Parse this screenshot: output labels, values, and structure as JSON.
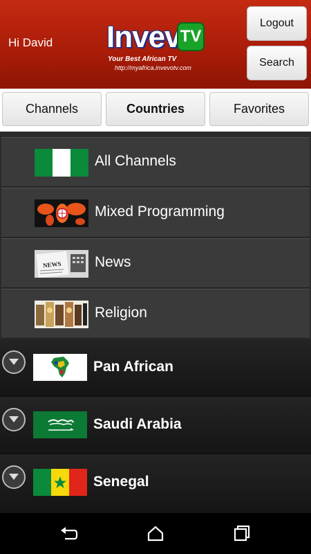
{
  "header": {
    "greeting": "Hi David",
    "logo": {
      "brand": "Invevo",
      "badge": "TV",
      "tagline": "Your Best African TV",
      "url": "http://myafrica.invevotv.com"
    },
    "logout_label": "Logout",
    "search_label": "Search"
  },
  "tabs": [
    {
      "label": "Channels",
      "selected": false
    },
    {
      "label": "Countries",
      "selected": true
    },
    {
      "label": "Favorites",
      "selected": false
    }
  ],
  "categories": [
    {
      "label": "All Channels",
      "thumb": "nigeria-flag"
    },
    {
      "label": "Mixed Programming",
      "thumb": "world-map"
    },
    {
      "label": "News",
      "thumb": "newspaper"
    },
    {
      "label": "Religion",
      "thumb": "religion-collage"
    }
  ],
  "countries": [
    {
      "label": "Pan African",
      "flag": "pan-african-map-flag"
    },
    {
      "label": "Saudi Arabia",
      "flag": "saudi-arabia-flag"
    },
    {
      "label": "Senegal",
      "flag": "senegal-flag"
    }
  ],
  "navbar": {
    "icons": [
      "back-icon",
      "home-icon",
      "recents-icon"
    ]
  },
  "colors": {
    "header_red": "#b8210c",
    "logo_blue": "#1b2b8a",
    "logo_green": "#1aa329"
  }
}
